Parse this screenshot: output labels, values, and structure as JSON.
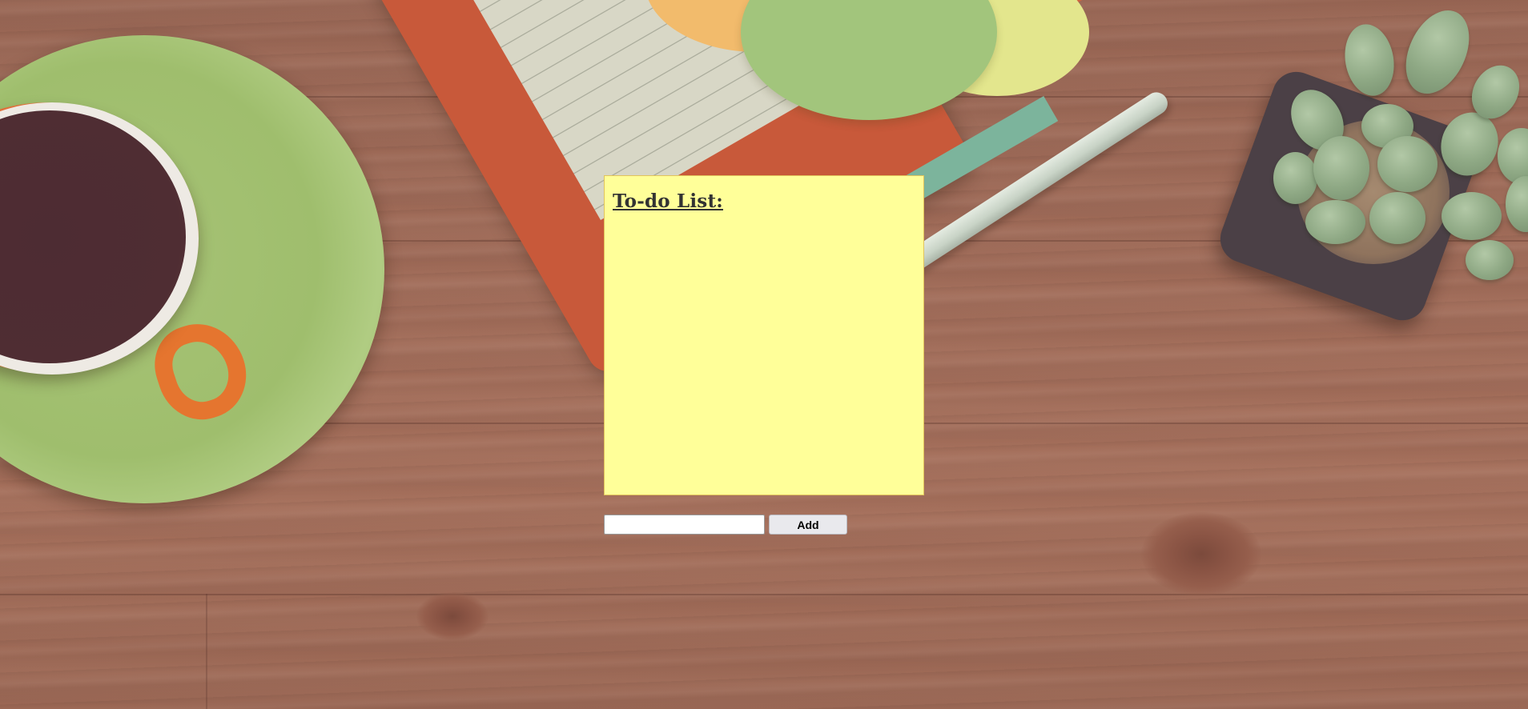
{
  "note": {
    "title": "To-do List:",
    "items": []
  },
  "form": {
    "input_value": "",
    "input_placeholder": "",
    "add_label": "Add"
  },
  "colors": {
    "note_bg": "#ffff99",
    "note_border": "#e1c45c",
    "title_text": "#333333",
    "button_bg": "#e9e9ed"
  }
}
